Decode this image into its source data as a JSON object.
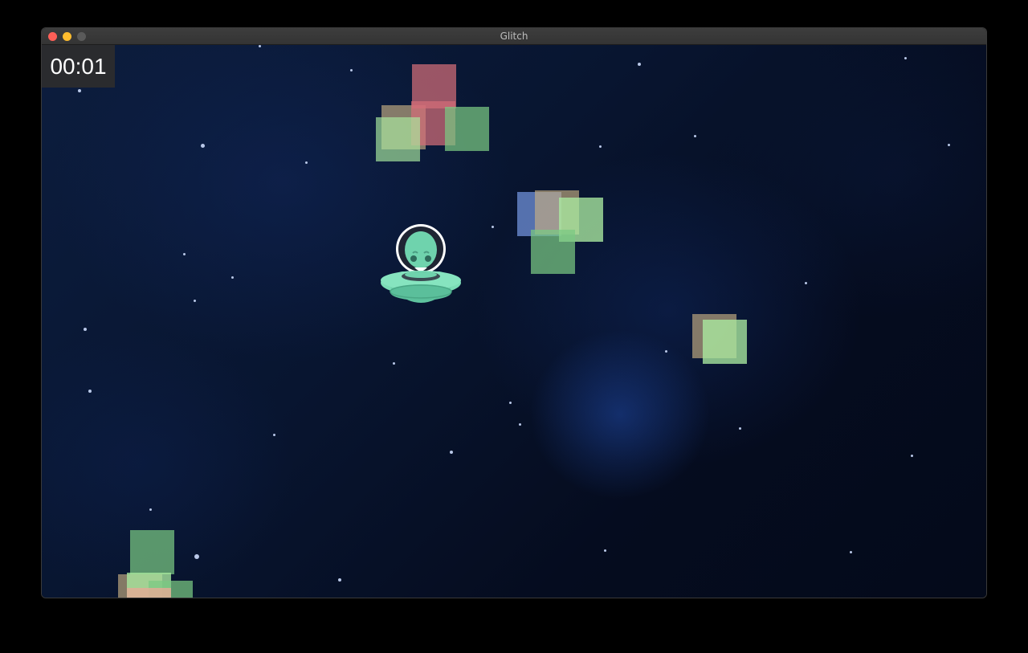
{
  "window": {
    "title": "Glitch"
  },
  "hud": {
    "timer": "00:01"
  },
  "player": {
    "icon": "alien-ufo-icon",
    "color": "#6fd3ad"
  },
  "colors": {
    "green_block": "#7ac982",
    "light_green_block": "#aaeba0",
    "red_block": "#d46e78",
    "blue_block": "#6c8cd2",
    "tan_block": "#c8af82",
    "background": "#081530"
  }
}
